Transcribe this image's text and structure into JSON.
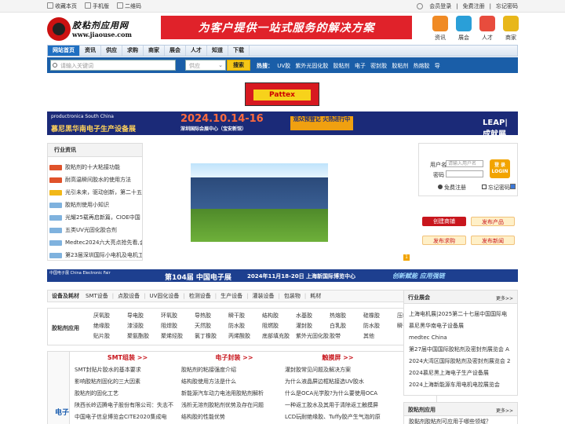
{
  "topbar": {
    "left": [
      "收藏本页",
      "手机版",
      "二维码"
    ],
    "right": [
      "会员登录",
      "免费注册",
      "忘记密码"
    ]
  },
  "logo": {
    "name": "胶粘剂应用网",
    "url": "www.jiaouse.com"
  },
  "top_banner": "为客户提供一站式服务的解决方案",
  "quick_links": [
    {
      "label": "资讯",
      "color": "#f08a24"
    },
    {
      "label": "展会",
      "color": "#2a9fd8"
    },
    {
      "label": "人才",
      "color": "#e84c3d"
    },
    {
      "label": "商家",
      "color": "#e8b71a"
    }
  ],
  "nav": [
    "网站首页",
    "资讯",
    "供应",
    "求购",
    "商家",
    "展会",
    "人才",
    "知道",
    "下载"
  ],
  "search": {
    "placeholder": "请输入关键词",
    "select": "供应",
    "button": "搜索"
  },
  "hot": {
    "label": "热搜：",
    "terms": [
      "UV胶",
      "紫外光固化胶",
      "胶粘剂",
      "电子",
      "密封胶",
      "胶粘剂",
      "热熔胶",
      "导"
    ]
  },
  "pattex": "Pattex",
  "expo_banner": {
    "brand": "productronica South China",
    "title": "慕尼黑华南电子生产设备展",
    "date": "2024.10.14-16",
    "venue": "深圳国际会展中心（宝安新馆）",
    "cta": "观众预登记 火热进行中",
    "leap": "LEAP| 成就展"
  },
  "news": {
    "title": "行业资讯",
    "items": [
      {
        "tag": "#e0522a",
        "text": "胶粘剂的十大粘接功能"
      },
      {
        "tag": "#e0522a",
        "text": "耐高温瞬间胶水的使用方法"
      },
      {
        "tag": "#f2b818",
        "text": "光引未来，驱动创新，第二十五"
      },
      {
        "tag": "#7fb2de",
        "text": "胶粘剂使用小知识"
      },
      {
        "tag": "#7fb2de",
        "text": "光耀25载再启新篇，CIOE中国"
      },
      {
        "tag": "#7fb2de",
        "text": "五类UV光固化胶合剂"
      },
      {
        "tag": "#7fb2de",
        "text": "Medtec2024六大亮点抢先看,会"
      },
      {
        "tag": "#7fb2de",
        "text": "第23届深圳国际小电机及电机工"
      }
    ]
  },
  "login": {
    "user_label": "用户名",
    "user_placeholder": "请输入用户名",
    "pass_label": "密码",
    "button": "登 录 LOGIN",
    "register": "免费注册",
    "forgot": "忘记密码"
  },
  "actions": [
    {
      "label": "创建商铺",
      "style": "red"
    },
    {
      "label": "发布产品",
      "style": "yellow"
    },
    {
      "label": "发布求购",
      "style": "yellow"
    },
    {
      "label": "发布新闻",
      "style": "yellow"
    }
  ],
  "slide_num": "1",
  "expo2": {
    "a": "中国电子展 China Electronic Fair",
    "b": "第104届 中国电子展",
    "c": "2024年11月18-20日   上海新国际博览中心",
    "d": "创新赋能 应用强链"
  },
  "catbar": {
    "head": "设备及耗材",
    "items": [
      "SMT设备",
      "点胶设备",
      "UV固化设备",
      "检测设备",
      "生产设备",
      "灌装设备",
      "包装物",
      "耗材"
    ]
  },
  "glue_apps": {
    "head": "胶粘剂应用",
    "items": [
      "厌氧胶",
      "导电胶",
      "环氧胶",
      "导热胶",
      "瞬干胶",
      "结构胶",
      "水基胶",
      "热熔胶",
      "硅橡胶",
      "压敏胶",
      "绝缘胶",
      "漆浸胶",
      "阻焊胶",
      "天然胶",
      "防水胶",
      "阻燃胶",
      "灌封胶",
      "白乳胶",
      "防水胶",
      "瞬干胶",
      "贴片胶",
      "聚氨酯胶",
      "聚烯烃胶",
      "氯丁橡胶",
      "丙烯酸胶",
      "底部填充胶",
      "紫外光固化胶",
      "胶带",
      "其他"
    ]
  },
  "columns": {
    "side": "电子",
    "cols": [
      {
        "head": "SMT组装 >>",
        "items": [
          "SMT封贴片胶水的基本要求",
          "影响胶粘剂固化的三大因素",
          "胶粘剂的固化工艺",
          "陕西长岭迈腾电子股份有限公司：失志不",
          "中国电子信息博览会CITE2020集成电"
        ]
      },
      {
        "head": "电子封装 >>",
        "items": [
          "胶粘剂的粘接强度介绍",
          "结构胶使用方法是什么",
          "新能源汽车动力电池用胶粘剂解析",
          "浅析无溶剂胶粘剂优势及存在问题",
          "结构胶的性能优势"
        ]
      },
      {
        "head": "触摸屏 >>",
        "items": [
          "灌封胶常见问题及解决方案",
          "为什么液晶屏边框粘接选UV胶水",
          "什么是OCA光学胶?为什么要使用OCA",
          "一种返工胶水及其用于清除返工触摸屏",
          "LCD玩耐绝缘胶、Tuffy胶产生气泡的原"
        ]
      }
    ]
  },
  "expo_box": {
    "title": "行业展会",
    "more": "更多>>",
    "items": [
      "上海电机展|2025第二十七届中国国际电",
      "慕尼黑华南电子设备展",
      "medtec China",
      "第27届中国国际胶粘剂及密封剂展览会 A",
      "2024大湾区国际胶粘剂及密封剂展览会 2",
      "2024慕尼黑上海电子生产设备展",
      "2024上海新能源车用电机电控展览会"
    ]
  },
  "apps_box": {
    "title": "胶粘剂应用",
    "more": "更多>>",
    "items": [
      "胶黏剂胶粘剂可应用于哪些领域？"
    ]
  }
}
